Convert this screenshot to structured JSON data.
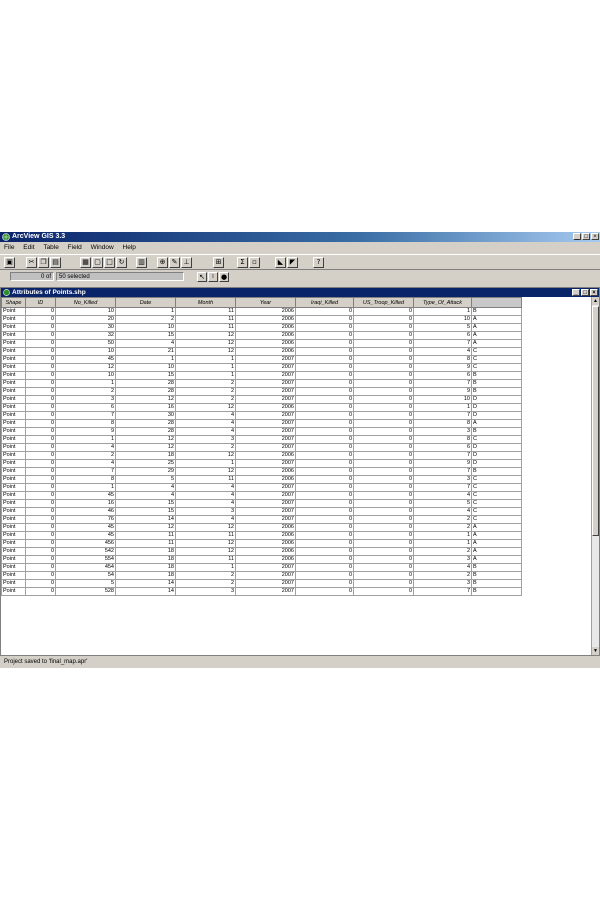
{
  "app": {
    "title": "ArcView GIS 3.3"
  },
  "window_buttons": [
    "_",
    "□",
    "×"
  ],
  "menu": [
    "File",
    "Edit",
    "Table",
    "Field",
    "Window",
    "Help"
  ],
  "status": {
    "selected_count": "0",
    "of_label": "of",
    "selected_text": "50 selected"
  },
  "table_window": {
    "title": "Attributes of Points.shp",
    "columns": [
      "Shape",
      "ID",
      "No_Killed",
      "Date",
      "Month",
      "Year",
      "Iraqi_Killed",
      "US_Troop_Killed",
      "Type_Of_Attack",
      ""
    ],
    "rows": [
      [
        "Point",
        "0",
        "10",
        "1",
        "11",
        "2006",
        "0",
        "0",
        "1",
        "B"
      ],
      [
        "Point",
        "0",
        "20",
        "2",
        "11",
        "2006",
        "0",
        "0",
        "10",
        "A"
      ],
      [
        "Point",
        "0",
        "30",
        "10",
        "11",
        "2006",
        "0",
        "0",
        "5",
        "A"
      ],
      [
        "Point",
        "0",
        "32",
        "15",
        "12",
        "2006",
        "0",
        "0",
        "6",
        "A"
      ],
      [
        "Point",
        "0",
        "50",
        "4",
        "12",
        "2006",
        "0",
        "0",
        "7",
        "A"
      ],
      [
        "Point",
        "0",
        "10",
        "21",
        "12",
        "2006",
        "0",
        "0",
        "4",
        "C"
      ],
      [
        "Point",
        "0",
        "45",
        "1",
        "1",
        "2007",
        "0",
        "0",
        "8",
        "C"
      ],
      [
        "Point",
        "0",
        "12",
        "10",
        "1",
        "2007",
        "0",
        "0",
        "9",
        "C"
      ],
      [
        "Point",
        "0",
        "10",
        "15",
        "1",
        "2007",
        "0",
        "0",
        "6",
        "B"
      ],
      [
        "Point",
        "0",
        "1",
        "28",
        "2",
        "2007",
        "0",
        "0",
        "7",
        "B"
      ],
      [
        "Point",
        "0",
        "2",
        "28",
        "2",
        "2007",
        "0",
        "0",
        "9",
        "B"
      ],
      [
        "Point",
        "0",
        "3",
        "12",
        "2",
        "2007",
        "0",
        "0",
        "10",
        "D"
      ],
      [
        "Point",
        "0",
        "6",
        "16",
        "12",
        "2006",
        "0",
        "0",
        "1",
        "D"
      ],
      [
        "Point",
        "0",
        "7",
        "30",
        "4",
        "2007",
        "0",
        "0",
        "7",
        "D"
      ],
      [
        "Point",
        "0",
        "8",
        "28",
        "4",
        "2007",
        "0",
        "0",
        "8",
        "A"
      ],
      [
        "Point",
        "0",
        "9",
        "28",
        "4",
        "2007",
        "0",
        "0",
        "3",
        "B"
      ],
      [
        "Point",
        "0",
        "1",
        "12",
        "3",
        "2007",
        "0",
        "0",
        "8",
        "C"
      ],
      [
        "Point",
        "0",
        "4",
        "12",
        "2",
        "2007",
        "0",
        "0",
        "6",
        "D"
      ],
      [
        "Point",
        "0",
        "2",
        "18",
        "12",
        "2006",
        "0",
        "0",
        "7",
        "D"
      ],
      [
        "Point",
        "0",
        "4",
        "25",
        "1",
        "2007",
        "0",
        "0",
        "9",
        "D"
      ],
      [
        "Point",
        "0",
        "7",
        "29",
        "12",
        "2006",
        "0",
        "0",
        "7",
        "B"
      ],
      [
        "Point",
        "0",
        "8",
        "5",
        "11",
        "2006",
        "0",
        "0",
        "3",
        "C"
      ],
      [
        "Point",
        "0",
        "1",
        "4",
        "4",
        "2007",
        "0",
        "0",
        "7",
        "C"
      ],
      [
        "Point",
        "0",
        "45",
        "4",
        "4",
        "2007",
        "0",
        "0",
        "4",
        "C"
      ],
      [
        "Point",
        "0",
        "16",
        "15",
        "4",
        "2007",
        "0",
        "0",
        "5",
        "C"
      ],
      [
        "Point",
        "0",
        "46",
        "15",
        "3",
        "2007",
        "0",
        "0",
        "4",
        "C"
      ],
      [
        "Point",
        "0",
        "76",
        "14",
        "4",
        "2007",
        "0",
        "0",
        "2",
        "C"
      ],
      [
        "Point",
        "0",
        "45",
        "12",
        "12",
        "2006",
        "0",
        "0",
        "2",
        "A"
      ],
      [
        "Point",
        "0",
        "45",
        "11",
        "11",
        "2006",
        "0",
        "0",
        "1",
        "A"
      ],
      [
        "Point",
        "0",
        "456",
        "11",
        "12",
        "2006",
        "0",
        "0",
        "1",
        "A"
      ],
      [
        "Point",
        "0",
        "542",
        "18",
        "12",
        "2006",
        "0",
        "0",
        "2",
        "A"
      ],
      [
        "Point",
        "0",
        "554",
        "18",
        "11",
        "2006",
        "0",
        "0",
        "3",
        "A"
      ],
      [
        "Point",
        "0",
        "454",
        "18",
        "1",
        "2007",
        "0",
        "0",
        "4",
        "B"
      ],
      [
        "Point",
        "0",
        "54",
        "18",
        "2",
        "2007",
        "0",
        "0",
        "2",
        "B"
      ],
      [
        "Point",
        "0",
        "5",
        "14",
        "2",
        "2007",
        "0",
        "0",
        "3",
        "B"
      ],
      [
        "Point",
        "0",
        "528",
        "14",
        "3",
        "2007",
        "0",
        "0",
        "7",
        "B"
      ]
    ]
  },
  "status_bar": {
    "message": "Project saved to 'final_map.apr'"
  },
  "icons": [
    "app-globe-icon",
    "save-icon",
    "cut-icon",
    "copy-icon",
    "paste-icon",
    "table-icon",
    "refresh-icon",
    "chart-icon",
    "find-icon",
    "query-icon",
    "sum-icon",
    "sort-asc-icon",
    "sort-desc-icon",
    "help-icon",
    "pointer-icon",
    "edit-icon",
    "identify-icon"
  ]
}
